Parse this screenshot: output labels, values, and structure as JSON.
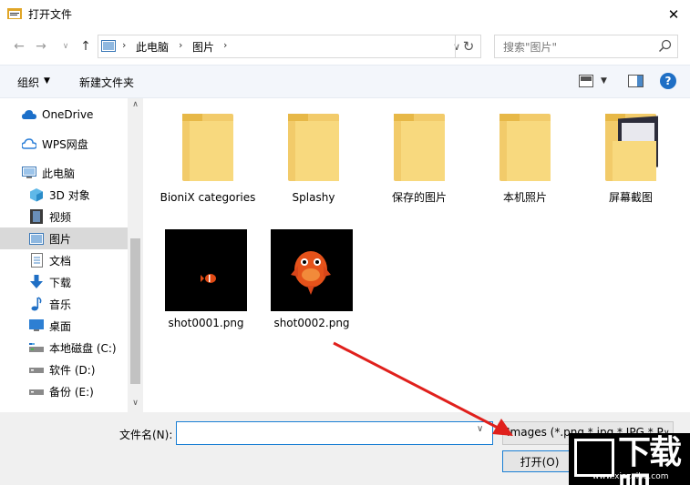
{
  "window": {
    "title": "打开文件"
  },
  "address": {
    "crumbs": [
      "此电脑",
      "图片"
    ]
  },
  "search": {
    "placeholder": "搜索\"图片\""
  },
  "toolbar": {
    "organize": "组织",
    "new_folder": "新建文件夹",
    "help": "?"
  },
  "sidebar": {
    "items": [
      {
        "label": "OneDrive",
        "icon": "cloud-icon"
      },
      {
        "label": "WPS网盘",
        "icon": "wps-cloud-icon"
      },
      {
        "label": "此电脑",
        "icon": "computer-icon"
      },
      {
        "label": "3D 对象",
        "icon": "cube-icon"
      },
      {
        "label": "视频",
        "icon": "video-icon"
      },
      {
        "label": "图片",
        "icon": "pictures-icon",
        "selected": true
      },
      {
        "label": "文档",
        "icon": "document-icon"
      },
      {
        "label": "下载",
        "icon": "download-icon"
      },
      {
        "label": "音乐",
        "icon": "music-icon"
      },
      {
        "label": "桌面",
        "icon": "desktop-icon"
      },
      {
        "label": "本地磁盘 (C:)",
        "icon": "drive-icon"
      },
      {
        "label": "软件 (D:)",
        "icon": "drive-icon"
      },
      {
        "label": "备份 (E:)",
        "icon": "drive-icon"
      }
    ]
  },
  "files": [
    {
      "name": "BioniX categories",
      "type": "folder"
    },
    {
      "name": "Splashy",
      "type": "folder"
    },
    {
      "name": "保存的图片",
      "type": "folder"
    },
    {
      "name": "本机照片",
      "type": "folder"
    },
    {
      "name": "屏幕截图",
      "type": "folder"
    },
    {
      "name": "shot0001.png",
      "type": "image"
    },
    {
      "name": "shot0002.png",
      "type": "image"
    }
  ],
  "bottom": {
    "filename_label": "文件名(N):",
    "filename_value": "",
    "filter": "Images (*.png,*.jpg,*.JPG,*.P",
    "open_button": "打开(O)"
  },
  "watermark": {
    "text": "下载吧",
    "url": "www.xiazaiba.com"
  },
  "colors": {
    "accent": "#1a7fd4",
    "folder": "#f8d97e",
    "arrow": "#e0201c"
  }
}
